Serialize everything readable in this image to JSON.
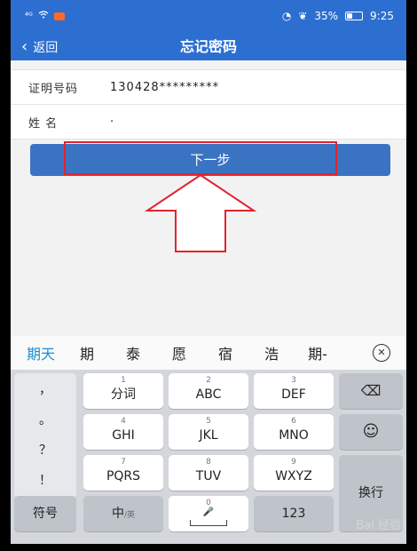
{
  "status": {
    "signal": "⁴ᴳ",
    "battery_pct": "35%",
    "time": "9:25"
  },
  "nav": {
    "back_label": "返回",
    "title": "忘记密码"
  },
  "form": {
    "id_label": "证明号码",
    "id_value": "130428*********",
    "name_label": "姓 名",
    "name_value": "·"
  },
  "next_button": {
    "label": "下一步"
  },
  "candidates": [
    "期天",
    "期",
    "泰",
    "愿",
    "宿",
    "浩",
    "期-"
  ],
  "keyboard": {
    "punct": [
      "，",
      "。",
      "？",
      "！"
    ],
    "keys": [
      {
        "num": "1",
        "label": "分词"
      },
      {
        "num": "2",
        "label": "ABC"
      },
      {
        "num": "3",
        "label": "DEF"
      },
      {
        "num": "4",
        "label": "GHI"
      },
      {
        "num": "5",
        "label": "JKL"
      },
      {
        "num": "6",
        "label": "MNO"
      },
      {
        "num": "7",
        "label": "PQRS"
      },
      {
        "num": "8",
        "label": "TUV"
      },
      {
        "num": "9",
        "label": "WXYZ"
      }
    ],
    "right_keys": {
      "delete": "⌫",
      "emoji": "☺",
      "newline": "换行"
    },
    "bottom": {
      "symbols": "符号",
      "lang": "中",
      "lang_sub": "/英",
      "space_num": "0",
      "numeric": "123"
    }
  },
  "watermark": {
    "main": "Bai 经验",
    "sub": "jingyan.baidu.com"
  }
}
